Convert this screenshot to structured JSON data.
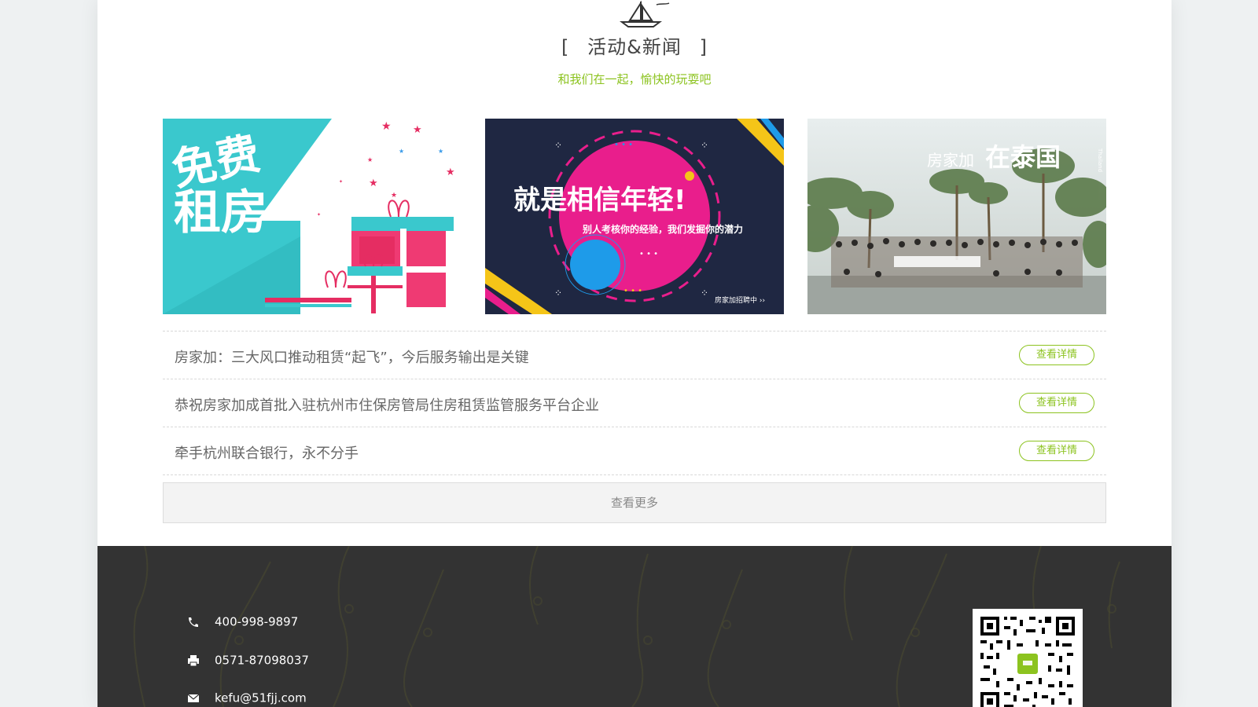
{
  "section": {
    "title_open": "[",
    "title": "活动&新闻",
    "title_close": "]",
    "subtitle": "和我们在一起，愉快的玩耍吧",
    "accent_color": "#8cc31f",
    "icon": "sailboat-icon"
  },
  "cards": [
    {
      "name": "free-rent-card",
      "line1": "免费",
      "line2": "租房",
      "colors": [
        "#3ac8cd",
        "#ef3a73",
        "#e91e63"
      ]
    },
    {
      "name": "recruit-card",
      "headline": "就是相信年轻!",
      "sub": "别人考核你的经验，我们发掘你的潜力",
      "footer": "房家加招聘中 ››",
      "colors": [
        "#1f2742",
        "#e91e8c",
        "#1e9be9",
        "#f5c518"
      ]
    },
    {
      "name": "thailand-trip-card",
      "brand": "房家加",
      "headline": "在泰国",
      "vertical": "Thailand",
      "colors": [
        "#cfd8d6",
        "#6b8a5a"
      ]
    }
  ],
  "news": [
    {
      "title": "房家加：三大风口推动租赁“起飞”，今后服务输出是关键",
      "button": "查看详情"
    },
    {
      "title": "恭祝房家加成首批入驻杭州市住保房管局住房租赁监管服务平台企业",
      "button": "查看详情"
    },
    {
      "title": "牵手杭州联合银行，永不分手",
      "button": "查看详情"
    }
  ],
  "more_button": "查看更多",
  "footer": {
    "background_color": "#333333",
    "contacts": [
      {
        "icon": "phone-icon",
        "text": "400-998-9897"
      },
      {
        "icon": "fax-icon",
        "text": "0571-87098037"
      },
      {
        "icon": "mail-icon",
        "text": "kefu@51fjj.com"
      }
    ],
    "qr_icon": "qr-code-icon"
  }
}
